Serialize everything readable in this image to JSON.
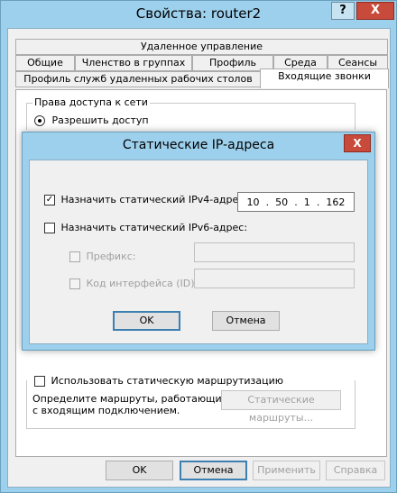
{
  "window": {
    "title": "Свойства: router2",
    "help_label": "?",
    "close_label": "X"
  },
  "tabs": {
    "row1": [
      "Удаленное управление"
    ],
    "row2": [
      "Общие",
      "Членство в группах",
      "Профиль",
      "Среда",
      "Сеансы"
    ],
    "row3": [
      "Профиль служб удаленных рабочих столов",
      "Входящие звонки"
    ]
  },
  "network_access": {
    "group_label": "Права доступа к сети",
    "allow_label": "Разрешить доступ"
  },
  "routing": {
    "checkbox_label": "Использовать статическую маршрутизацию",
    "description_line1": "Определите маршруты, работающие",
    "description_line2": "с  входящим подключением.",
    "button_label": "Статические маршруты..."
  },
  "footer": {
    "ok": "OK",
    "cancel": "Отмена",
    "apply": "Применить",
    "help": "Справка"
  },
  "dialog": {
    "title": "Статические IP-адреса",
    "close_label": "X",
    "ipv4_label": "Назначить статический IPv4-адрес:",
    "ipv4_checked": true,
    "ipv4_octets": [
      "10",
      "50",
      "1",
      "162"
    ],
    "ipv6_label": "Назначить статический IPv6-адрес:",
    "ipv6_checked": false,
    "prefix_label": "Префикс:",
    "interface_label": "Код интерфейса (ID):",
    "ok": "OK",
    "cancel": "Отмена"
  },
  "colors": {
    "frame": "#9dd0ec",
    "close": "#c84a3a",
    "default_button_border": "#3c7fb1"
  }
}
